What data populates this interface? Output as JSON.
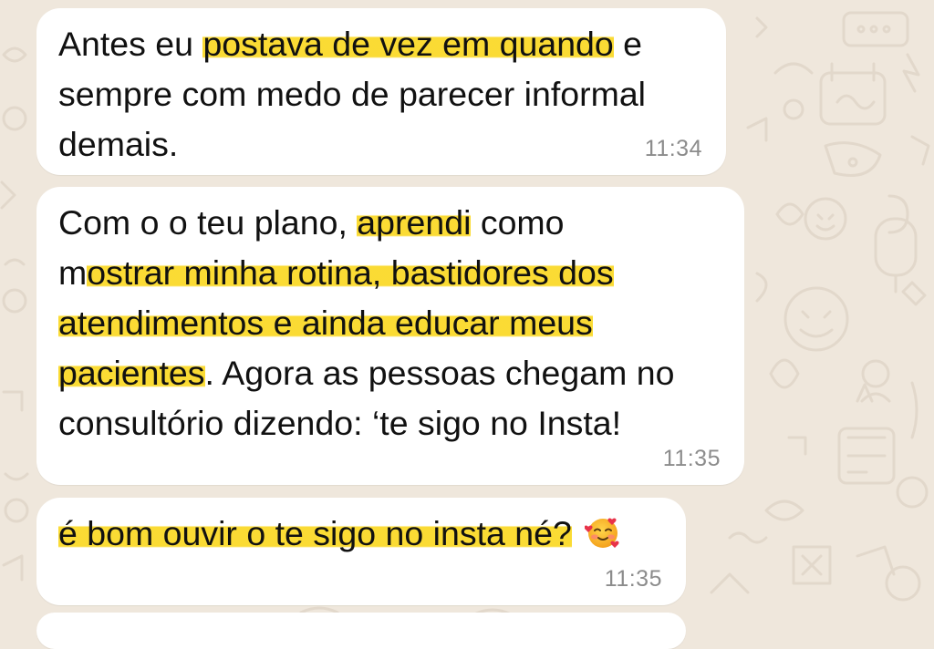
{
  "wallpaper": {
    "background": "#efe7dc",
    "doodle_color": "#e2d8cb"
  },
  "highlight_color": "#fad618",
  "messages": [
    {
      "lines": [
        [
          "Antes eu ",
          {
            "hl": "postava de vez em quando"
          },
          " e"
        ],
        [
          "sempre com medo de parecer informal"
        ],
        [
          "demais."
        ]
      ],
      "time": "11:34"
    },
    {
      "lines": [
        [
          "Com o o teu plano, ",
          {
            "hl": "aprendi"
          },
          " como"
        ],
        [
          "m",
          {
            "hl": "ostrar minha rotina, bastidores dos"
          }
        ],
        [
          {
            "hl": "atendimentos e ainda educar meus"
          }
        ],
        [
          {
            "hl": "pacientes"
          },
          ". Agora as pessoas chegam no"
        ],
        [
          "consultório dizendo: ‘te sigo no Insta!"
        ]
      ],
      "time": "11:35"
    },
    {
      "lines": [
        [
          {
            "hl": "é bom ouvir o te sigo no insta né?"
          },
          " "
        ]
      ],
      "emoji": "smiling-face-with-hearts-icon",
      "time": "11:35"
    }
  ]
}
